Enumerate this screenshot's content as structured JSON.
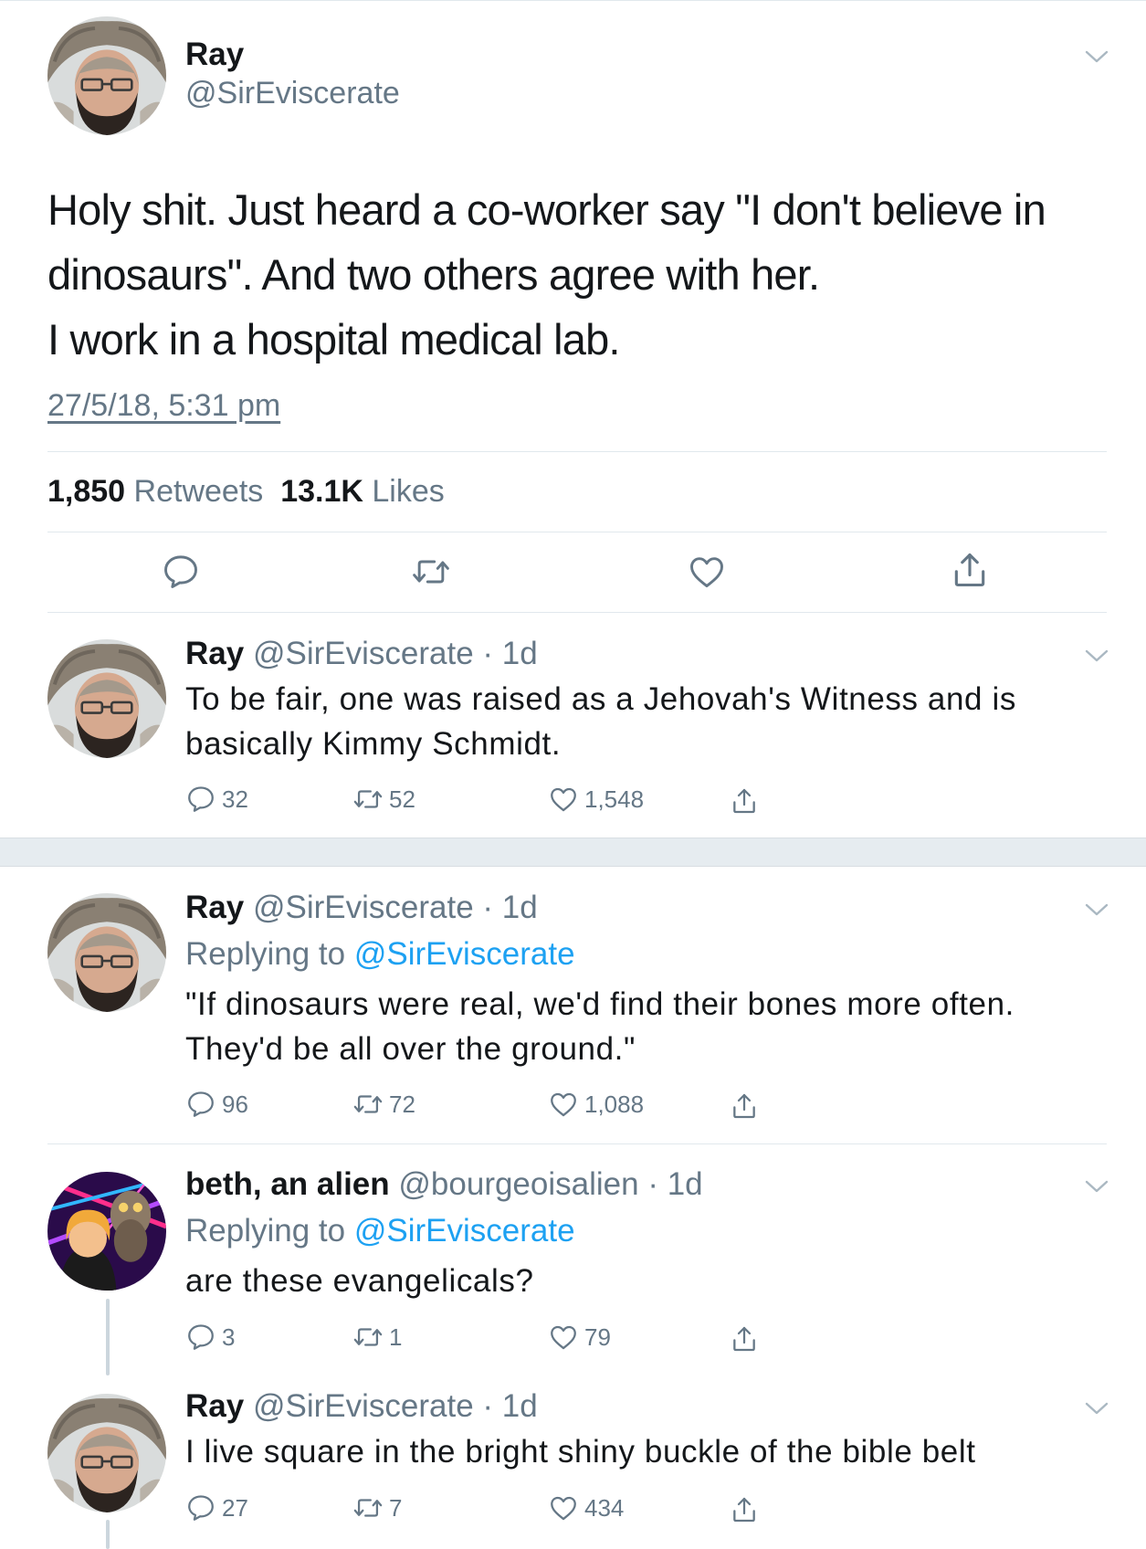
{
  "colors": {
    "text": "#14171a",
    "secondary": "#657786",
    "link": "#1da1f2",
    "divider": "#e1e8ed",
    "band": "#e6ecf0"
  },
  "main_tweet": {
    "name": "Ray",
    "handle": "@SirEviscerate",
    "text_lines": [
      "Holy shit. Just heard a co-worker say \"I don't believe in",
      "dinosaurs\". And two others agree with her.",
      "I work in a hospital medical lab."
    ],
    "timestamp": "27/5/18, 5:31 pm",
    "retweets_count": "1,850",
    "retweets_label": "Retweets",
    "likes_count": "13.1K",
    "likes_label": "Likes",
    "actions": [
      "reply-icon",
      "retweet-icon",
      "like-icon",
      "share-icon"
    ]
  },
  "replies": [
    {
      "name": "Ray",
      "meta": "@SirEviscerate · 1d",
      "replying_prefix": "",
      "replying_to": "",
      "text_lines": [
        "To be fair, one was raised as a Jehovah's Witness and is",
        "basically Kimmy Schmidt."
      ],
      "reply_count": "32",
      "retweet_count": "52",
      "like_count": "1,548"
    },
    {
      "name": "Ray",
      "meta": "@SirEviscerate · 1d",
      "replying_prefix": "Replying to",
      "replying_to": "@SirEviscerate",
      "text_lines": [
        "\"If dinosaurs were real, we'd find their bones more often.",
        "They'd be all over the ground.\""
      ],
      "reply_count": "96",
      "retweet_count": "72",
      "like_count": "1,088"
    },
    {
      "name": "beth, an alien",
      "meta": "@bourgeoisalien · 1d",
      "replying_prefix": "Replying to",
      "replying_to": "@SirEviscerate",
      "text_lines": [
        "are these evangelicals?"
      ],
      "reply_count": "3",
      "retweet_count": "1",
      "like_count": "79"
    },
    {
      "name": "Ray",
      "meta": "@SirEviscerate · 1d",
      "replying_prefix": "",
      "replying_to": "",
      "text_lines": [
        "I live square in the bright shiny buckle of the bible belt"
      ],
      "reply_count": "27",
      "retweet_count": "7",
      "like_count": "434"
    }
  ]
}
